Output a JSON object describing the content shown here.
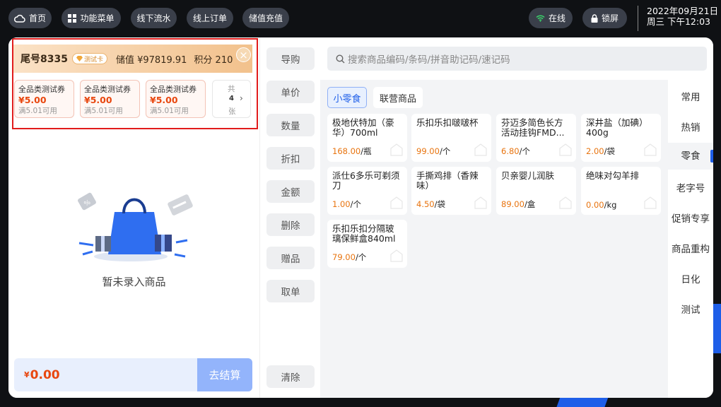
{
  "topbar": {
    "home": "首页",
    "menu": "功能菜单",
    "offline_flow": "线下流水",
    "online_order": "线上订单",
    "recharge": "储值充值",
    "online_status": "在线",
    "lock": "锁屏",
    "date": "2022年09月21日",
    "weekday_time": "周三 下午12:03"
  },
  "member": {
    "tail_number": "尾号8335",
    "card_tag": "测试卡",
    "stored_value": "储值 ¥97819.91",
    "points": "积分 210",
    "close": "×"
  },
  "coupons": [
    {
      "name": "全品类测试券",
      "value": "¥5.00",
      "condition": "满5.01可用"
    },
    {
      "name": "全品类测试券",
      "value": "¥5.00",
      "condition": "满5.01可用"
    },
    {
      "name": "全品类测试券",
      "value": "¥5.00",
      "condition": "满5.01可用"
    }
  ],
  "coupon_more": {
    "prefix": "共",
    "count": "4",
    "unit": "张"
  },
  "cart": {
    "empty_text": "暂未录入商品",
    "currency": "¥",
    "total": "0.00",
    "checkout": "去结算"
  },
  "actions": [
    "导购",
    "单价",
    "数量",
    "折扣",
    "金额",
    "删除",
    "赠品",
    "取单"
  ],
  "clear": "清除",
  "search": {
    "placeholder": "搜索商品编码/条码/拼音助记码/速记码"
  },
  "chips": [
    "小零食",
    "联营商品"
  ],
  "products": [
    {
      "name": "极地伏特加（豪华）700ml",
      "price": "168.00",
      "unit": "/瓶"
    },
    {
      "name": "乐扣乐扣啵啵杯",
      "price": "99.00",
      "unit": "/个"
    },
    {
      "name": "芬迈多简色长方活动挂钩FMD...",
      "price": "6.80",
      "unit": "/个"
    },
    {
      "name": "深井盐（加碘）400g",
      "price": "2.00",
      "unit": "/袋"
    },
    {
      "name": "派仕6多乐可剃须刀",
      "price": "1.00",
      "unit": "/个"
    },
    {
      "name": "手撕鸡排（香辣味）",
      "price": "4.50",
      "unit": "/袋"
    },
    {
      "name": "贝亲婴儿润肤",
      "price": "89.00",
      "unit": "/盒"
    },
    {
      "name": "绝味对勾羊排",
      "price": "0.00",
      "unit": "/kg"
    },
    {
      "name": "乐扣乐扣分隔玻璃保鲜盒840ml",
      "price": "79.00",
      "unit": "/个"
    }
  ],
  "categories": [
    "常用",
    "热销",
    "零食",
    "老字号",
    "促销专享",
    "商品重构",
    "日化",
    "测试"
  ],
  "colors": {
    "accent": "#1e5ee8",
    "price": "#e8740f",
    "highlight": "#e11c1c"
  }
}
